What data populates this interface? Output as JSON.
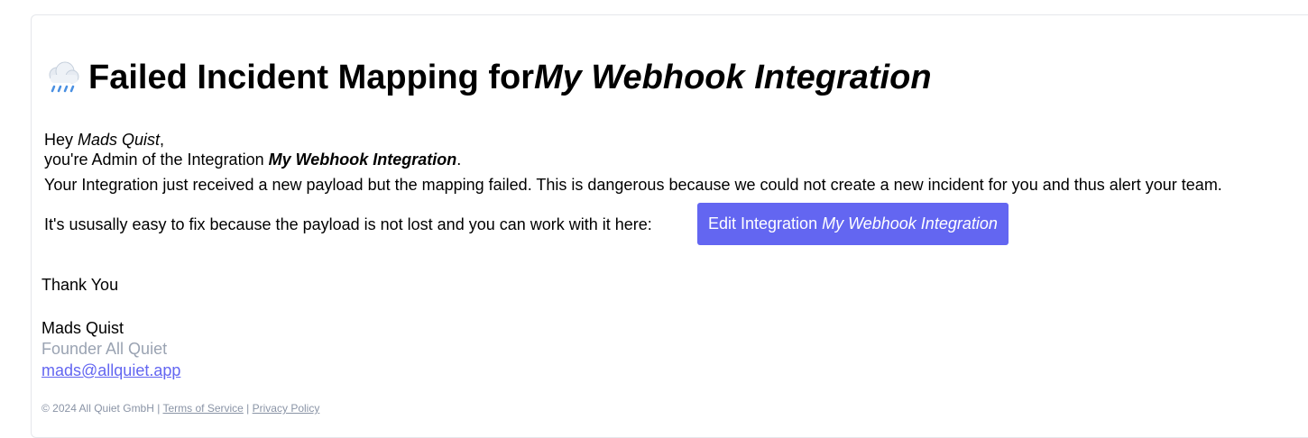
{
  "header": {
    "icon": "cloud-with-rain-icon",
    "title_prefix": "Failed Incident Mapping for ",
    "title_integration": "My Webhook Integration"
  },
  "greeting": {
    "hey": "Hey ",
    "name": "Mads Quist",
    "comma": ","
  },
  "admin_line": {
    "prefix": "you're Admin of the Integration ",
    "integration": "My Webhook Integration",
    "suffix": "."
  },
  "message": "Your Integration just received a new payload but the mapping failed. This is dangerous because we could not create a new incident for you and thus alert your team.",
  "fix_line": {
    "text": "It's ususally easy to fix because the payload is not lost and you can work with it here:"
  },
  "edit_button": {
    "prefix": "Edit Integration ",
    "integration": "My Webhook Integration",
    "color": "#6366f1"
  },
  "signature": {
    "thanks": "Thank You",
    "name": "Mads Quist",
    "role": "Founder All Quiet",
    "email": "mads@allquiet.app"
  },
  "footer": {
    "copyright": "© 2024 All Quiet GmbH",
    "separator": " | ",
    "terms": "Terms of Service",
    "privacy": "Privacy Policy"
  }
}
